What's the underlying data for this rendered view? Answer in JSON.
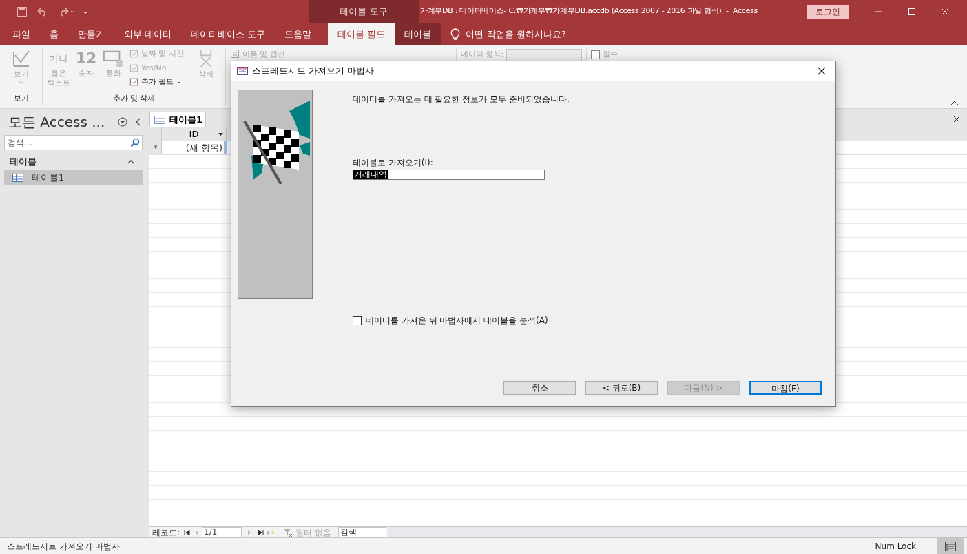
{
  "title_bar": {
    "context_label": "테이블 도구",
    "title": "가계부DB : 데이터베이스- C:₩가계부₩가계부DB.accdb (Access 2007 - 2016 파일 형식)  -  Access",
    "sign_in": "로그인"
  },
  "ribbon_tabs": [
    {
      "label": "파일",
      "selected": false,
      "kind": "normal"
    },
    {
      "label": "홈",
      "selected": false,
      "kind": "normal"
    },
    {
      "label": "만들기",
      "selected": false,
      "kind": "normal"
    },
    {
      "label": "외부 데이터",
      "selected": false,
      "kind": "normal"
    },
    {
      "label": "데이터베이스 도구",
      "selected": false,
      "kind": "normal"
    },
    {
      "label": "도움말",
      "selected": false,
      "kind": "normal"
    },
    {
      "label": "테이블 필드",
      "selected": true,
      "kind": "context"
    },
    {
      "label": "테이블",
      "selected": false,
      "kind": "context"
    }
  ],
  "tell_me": "어떤 작업을 원하시나요?",
  "ribbon": {
    "view_button": {
      "label": "보기",
      "disabled": true
    },
    "view_group": "보기",
    "field_buttons": [
      {
        "glyph": "가나",
        "label": "짧은 텍스트",
        "disabled": true
      },
      {
        "glyph": "12",
        "label": "숫자",
        "disabled": true
      },
      {
        "label": "통화",
        "disabled": true
      }
    ],
    "small_buttons": [
      {
        "label": "날짜 및 시간",
        "disabled": true
      },
      {
        "label": "Yes/No",
        "disabled": true
      },
      {
        "label": "추가 필드",
        "disabled": false
      }
    ],
    "delete_button": {
      "label": "삭제",
      "disabled": true
    },
    "add_delete_group": "추가 및 삭제",
    "name_caption": "이름 및 캡션",
    "data_type_label": "데이터 형식:",
    "required": {
      "label": "필수",
      "checked": false
    }
  },
  "nav_pane": {
    "title": "모든 Access ...",
    "search_placeholder": "검색...",
    "groups": [
      {
        "label": "테이블",
        "expanded": true,
        "items": [
          {
            "label": "테이블1",
            "selected": true
          }
        ]
      }
    ]
  },
  "document": {
    "tabs": [
      {
        "label": "테이블1",
        "selected": true
      }
    ],
    "columns": [
      {
        "label": "ID"
      }
    ],
    "new_row": {
      "marker": "*",
      "cell": "(새 항목)"
    },
    "record_nav": {
      "label": "레코드:",
      "position": "1/1",
      "filter": "필터 없음",
      "search": "검색"
    }
  },
  "dialog": {
    "title": "스프레드시트 가져오기 마법사",
    "message": "데이터를 가져오는 데 필요한 정보가 모두 준비되었습니다.",
    "table_label": "테이블로 가져오기(I):",
    "table_value": "거래내역",
    "analyze": {
      "label": "데이터를 가져온 뒤 마법사에서 테이블을 분석(A)",
      "checked": false
    },
    "buttons": [
      {
        "label": "취소",
        "disabled": false,
        "default": false
      },
      {
        "label": "< 뒤로(B)",
        "disabled": false,
        "default": false
      },
      {
        "label": "다음(N) >",
        "disabled": true,
        "default": false
      },
      {
        "label": "마침(F)",
        "disabled": false,
        "default": true
      }
    ]
  },
  "status_bar": {
    "text": "스프레드시트 가져오기 마법사",
    "num_lock": "Num Lock"
  }
}
